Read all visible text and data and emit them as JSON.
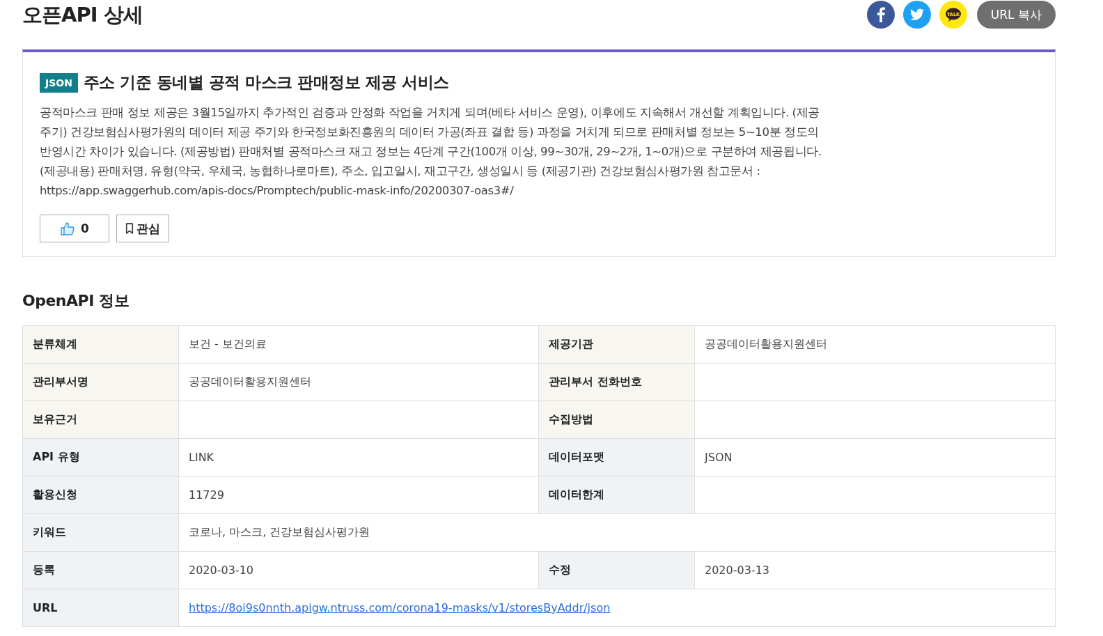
{
  "page_title": "오픈API 상세",
  "share": {
    "kakao_label": "TALK",
    "copy_button": "URL 복사"
  },
  "service": {
    "format_badge": "JSON",
    "title": "주소 기준 동네별 공적 마스크 판매정보 제공 서비스",
    "description": "공적마스크 판매 정보 제공은 3월15일까지 추가적인 검증과 안정화 작업을 거치게 되며(베타 서비스 운영), 이후에도 지속해서 개선할 계획입니다. (제공주기) 건강보험심사평가원의 데이터 제공 주기와 한국정보화진흥원의 데이터 가공(좌표 결합 등) 과정을 거치게 되므로 판매처별 정보는 5~10분 정도의 반영시간 차이가 있습니다. (제공방법) 판매처별 공적마스크 재고 정보는 4단계 구간(100개 이상, 99~30개, 29~2개, 1~0개)으로 구분하여 제공됩니다. (제공내용) 판매처명, 유형(약국, 우체국, 농협하나로마트), 주소, 입고일시, 재고구간, 생성일시 등 (제공기관) 건강보험심사평가원 참고문서 : https://app.swaggerhub.com/apis-docs/Promptech/public-mask-info/20200307-oas3#/",
    "like_count": "0",
    "bookmark_label": "관심"
  },
  "section_title": "OpenAPI 정보",
  "table": {
    "rows": [
      {
        "kind": "basic",
        "cells": [
          {
            "label": "분류체계",
            "value": "보건 - 보건의료"
          },
          {
            "label": "제공기관",
            "value": "공공데이터활용지원센터"
          }
        ]
      },
      {
        "kind": "basic",
        "cells": [
          {
            "label": "관리부서명",
            "value": "공공데이터활용지원센터"
          },
          {
            "label": "관리부서 전화번호"
          }
        ]
      },
      {
        "kind": "basic",
        "cells": [
          {
            "label": "보유근거"
          },
          {
            "label": "수집방법"
          }
        ]
      },
      {
        "kind": "detail",
        "cells": [
          {
            "label": "API 유형",
            "value": "LINK"
          },
          {
            "label": "데이터포맷",
            "value": "JSON"
          }
        ]
      },
      {
        "kind": "detail",
        "cells": [
          {
            "label": "활용신청",
            "value": "11729"
          },
          {
            "label": "데이터한계"
          }
        ]
      },
      {
        "kind": "detail",
        "cells": [
          {
            "label": "키워드",
            "value": "코로나, 마스크, 건강보험심사평가원"
          }
        ]
      },
      {
        "kind": "detail",
        "cells": [
          {
            "label": "등록",
            "value": "2020-03-10"
          },
          {
            "label": "수정",
            "value": "2020-03-13"
          }
        ]
      },
      {
        "kind": "detail",
        "cells": [
          {
            "label": "URL",
            "value": "https://8oi9s0nnth.apigw.ntruss.com/corona19-masks/v1/storesByAddr/json",
            "link": true
          }
        ]
      }
    ]
  }
}
